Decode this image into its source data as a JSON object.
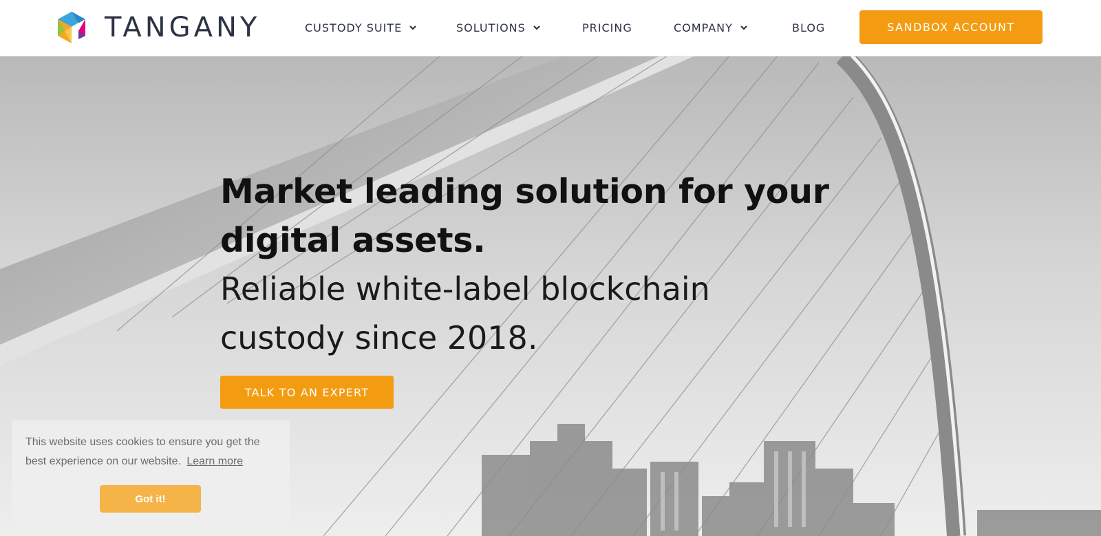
{
  "brand": {
    "name": "TANGANY",
    "logo_icon": "tangany-hexagon-logo",
    "logo_colors": [
      "#3aa6dc",
      "#e6007e",
      "#f5a623",
      "#8dc63f",
      "#6a3d9a"
    ]
  },
  "nav": {
    "items": [
      {
        "label": "CUSTODY SUITE",
        "has_dropdown": true
      },
      {
        "label": "SOLUTIONS",
        "has_dropdown": true
      },
      {
        "label": "PRICING",
        "has_dropdown": false
      },
      {
        "label": "COMPANY",
        "has_dropdown": true
      },
      {
        "label": "BLOG",
        "has_dropdown": false
      }
    ],
    "cta_label": "SANDBOX ACCOUNT",
    "dropdown_icon": "chevron-down-icon"
  },
  "hero": {
    "title": "Market leading solution for your digital assets.",
    "subtitle": "Reliable white-label blockchain custody since 2018.",
    "cta_label": "TALK TO AN EXPERT",
    "background": "grayscale arch bridge with suspension cables and city buildings"
  },
  "cookie_banner": {
    "message": "This website uses cookies to ensure you get the best experience on our website.",
    "link_label": "Learn more",
    "accept_label": "Got it!"
  },
  "colors": {
    "accent": "#f39c12",
    "accept_button": "#f5b447",
    "nav_text": "#2c3345",
    "header_bg": "#ffffff"
  }
}
